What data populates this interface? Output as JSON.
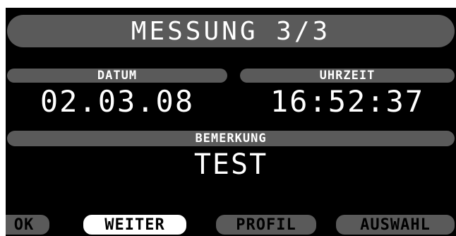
{
  "screen": {
    "title": "MESSUNG 3/3"
  },
  "fields": {
    "date": {
      "label": "DATUM",
      "value": "02.03.08"
    },
    "time": {
      "label": "UHRZEIT",
      "value": "16:52:37"
    },
    "note": {
      "label": "BEMERKUNG",
      "value": "TEST"
    }
  },
  "softkeys": {
    "ok": "OK",
    "next": "WEITER",
    "profile": "PROFIL",
    "select": "AUSWAHL"
  },
  "colors": {
    "background": "#000000",
    "bar": "#5a5a5a",
    "text": "#ffffff",
    "active_key": "#ffffff"
  }
}
